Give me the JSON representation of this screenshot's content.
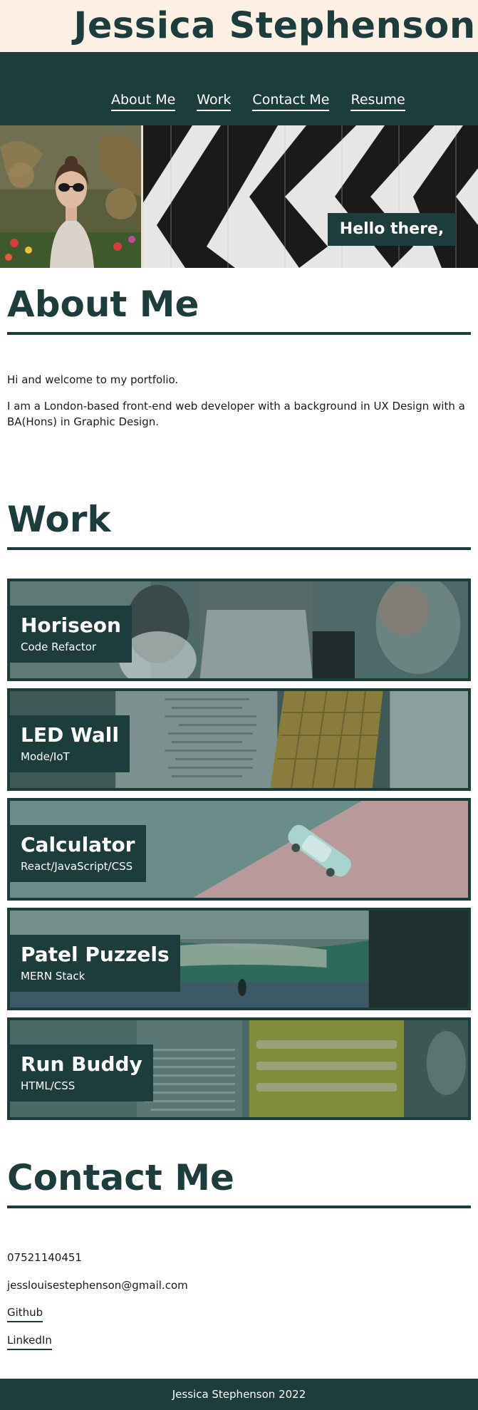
{
  "header": {
    "title": "Jessica Stephenson"
  },
  "nav": {
    "items": [
      {
        "label": "About Me"
      },
      {
        "label": "Work"
      },
      {
        "label": "Contact Me"
      },
      {
        "label": "Resume"
      }
    ]
  },
  "hero": {
    "greeting": "Hello there,"
  },
  "about": {
    "heading": "About Me",
    "paragraphs": [
      "Hi and welcome to my portfolio.",
      "I am a London-based front-end web developer with a background in UX Design with a BA(Hons) in Graphic Design."
    ]
  },
  "work": {
    "heading": "Work",
    "projects": [
      {
        "title": "Horiseon",
        "subtitle": "Code Refactor"
      },
      {
        "title": "LED Wall",
        "subtitle": "Mode/IoT"
      },
      {
        "title": "Calculator",
        "subtitle": "React/JavaScript/CSS"
      },
      {
        "title": "Patel Puzzels",
        "subtitle": "MERN Stack"
      },
      {
        "title": "Run Buddy",
        "subtitle": "HTML/CSS"
      }
    ]
  },
  "contact": {
    "heading": "Contact Me",
    "phone": "07521140451",
    "email": "jesslouisestephenson@gmail.com",
    "github_label": "Github",
    "linkedin_label": "LinkedIn"
  },
  "footer": {
    "text": "Jessica Stephenson 2022"
  },
  "colors": {
    "brand": "#1d3c3c",
    "header_bg": "#fcefe3"
  }
}
